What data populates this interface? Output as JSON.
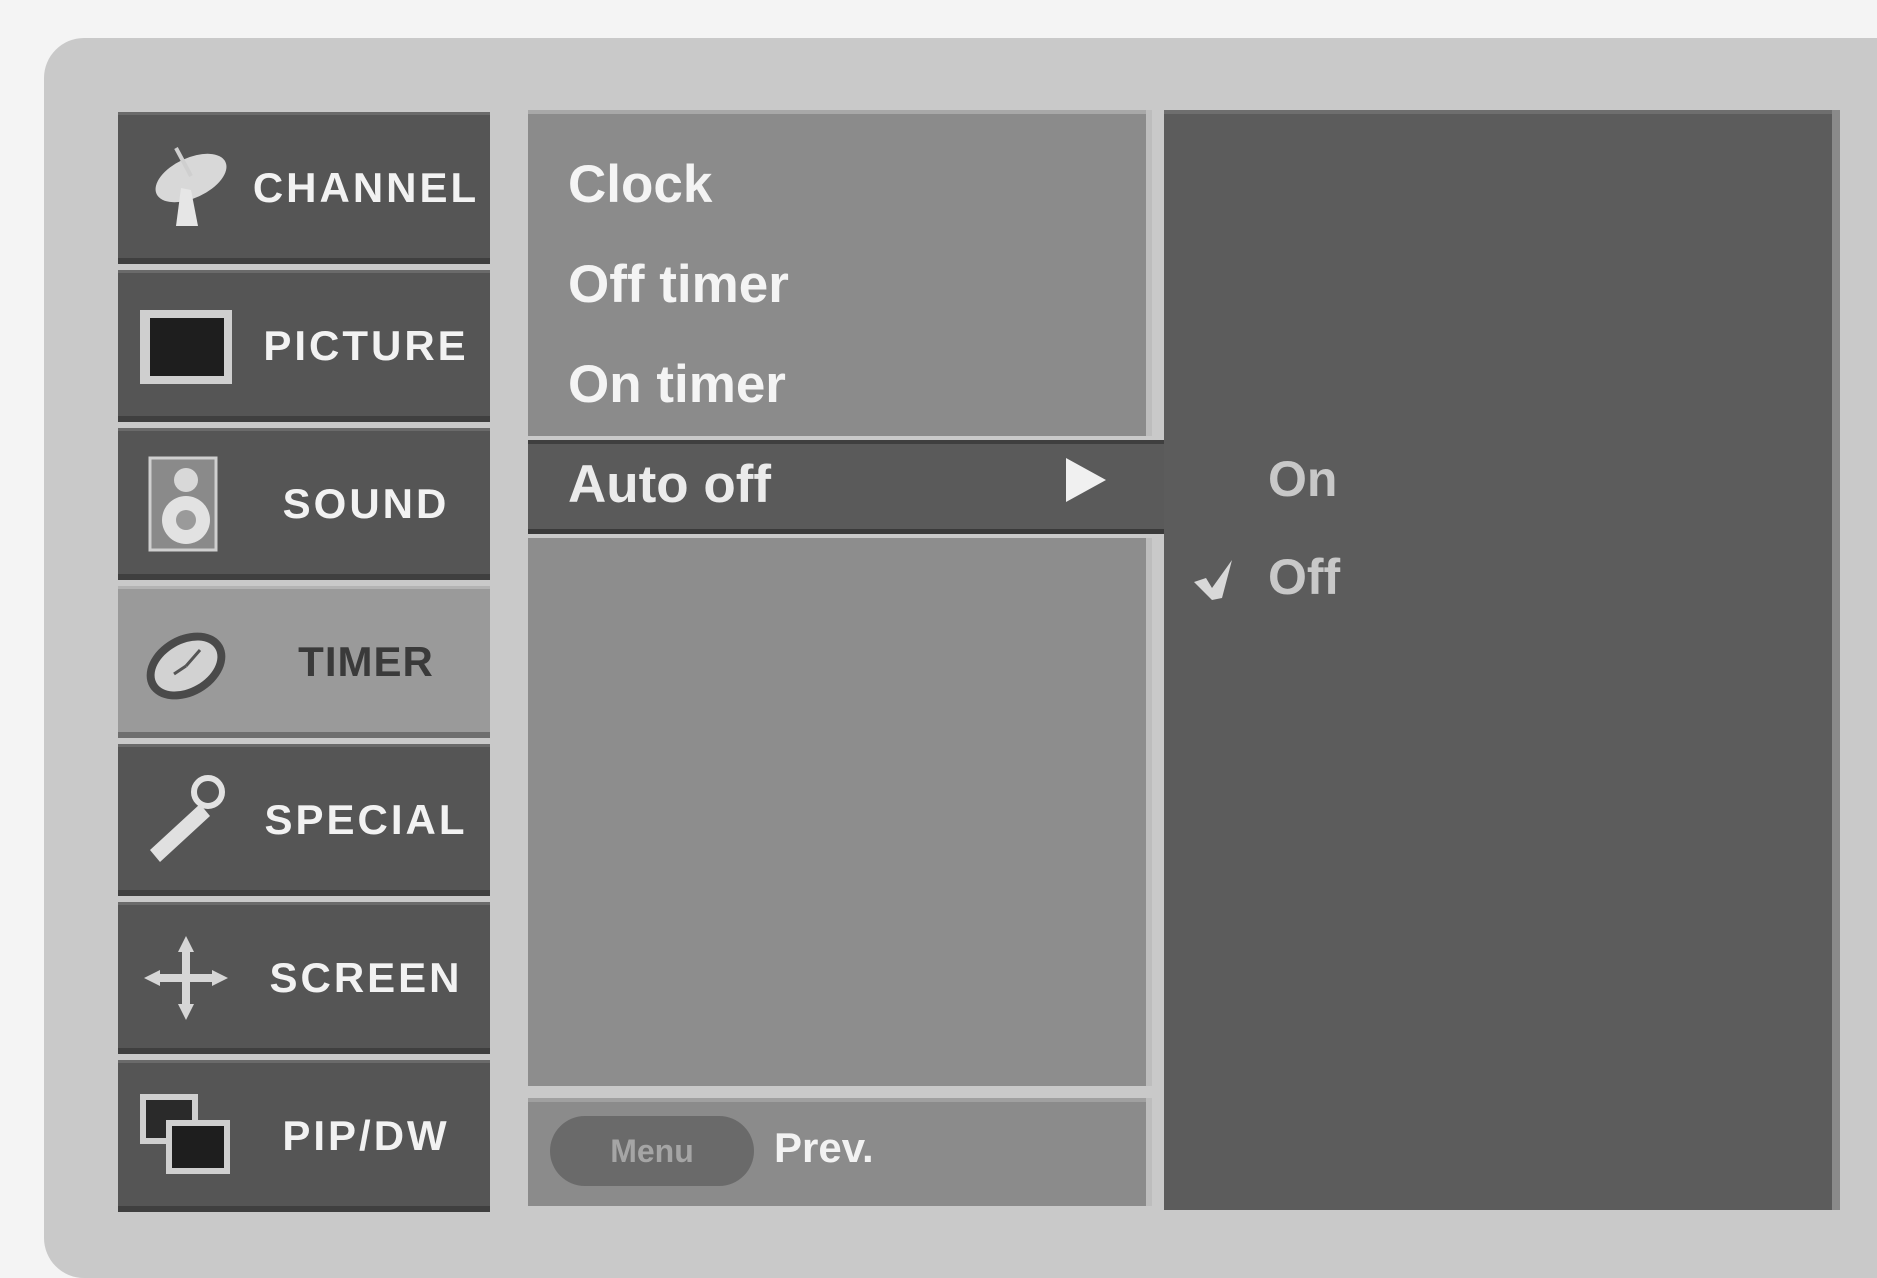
{
  "categories": [
    {
      "label": "CHANNEL",
      "icon": "satellite-dish-icon",
      "active": false
    },
    {
      "label": "PICTURE",
      "icon": "tv-screen-icon",
      "active": false
    },
    {
      "label": "SOUND",
      "icon": "speaker-icon",
      "active": false
    },
    {
      "label": "TIMER",
      "icon": "clock-icon",
      "active": true
    },
    {
      "label": "SPECIAL",
      "icon": "key-icon",
      "active": false
    },
    {
      "label": "SCREEN",
      "icon": "move-arrows-icon",
      "active": false
    },
    {
      "label": "PIP/DW",
      "icon": "pip-windows-icon",
      "active": false
    }
  ],
  "menu": {
    "items": [
      "Clock",
      "Off timer",
      "On timer"
    ],
    "selected": "Auto off",
    "selected_arrow_icon": "triangle-right-icon"
  },
  "submenu": {
    "options": [
      "On",
      "Off"
    ],
    "checked": "Off",
    "check_icon": "checkmark-icon"
  },
  "footer": {
    "menu_button": "Menu",
    "prev_label": "Prev."
  },
  "colors": {
    "panel_dark": "#555555",
    "panel_mid": "#8b8b8b",
    "panel_active": "#9a9a9a",
    "submenu_bg": "#5c5c5c",
    "text": "#f2f2f2"
  }
}
